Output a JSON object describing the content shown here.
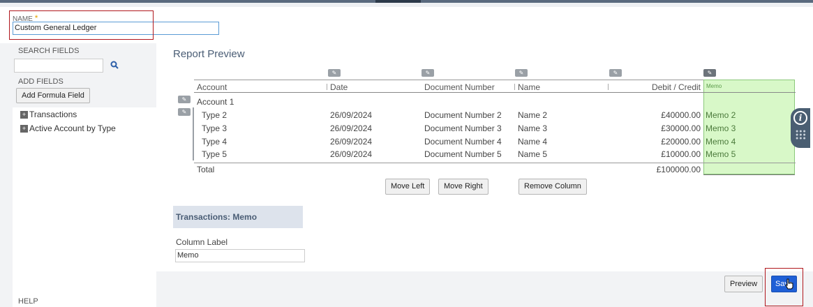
{
  "name_field": {
    "label": "NAME",
    "required_mark": "*",
    "value": "Custom General Ledger"
  },
  "left_panel": {
    "search_label": "SEARCH FIELDS",
    "search_icon": "search-icon",
    "add_fields_label": "ADD FIELDS",
    "add_formula_button": "Add Formula Field",
    "tree": [
      {
        "label": "Transactions",
        "icon": "plus-box-icon"
      },
      {
        "label": "Active Account by Type",
        "icon": "plus-box-icon"
      }
    ],
    "help_label": "HELP"
  },
  "report": {
    "title": "Report Preview",
    "columns": [
      "Account",
      "Date",
      "Document Number",
      "Name",
      "Debit / Credit",
      "Memo"
    ],
    "group_row": "Account 1",
    "rows": [
      {
        "account": "Type 2",
        "date": "26/09/2024",
        "doc": "Document Number 2",
        "name": "Name 2",
        "amount": "£40000.00",
        "memo": "Memo 2"
      },
      {
        "account": "Type 3",
        "date": "26/09/2024",
        "doc": "Document Number 3",
        "name": "Name 3",
        "amount": "£30000.00",
        "memo": "Memo 3"
      },
      {
        "account": "Type 4",
        "date": "26/09/2024",
        "doc": "Document Number 4",
        "name": "Name 4",
        "amount": "£20000.00",
        "memo": "Memo 4"
      },
      {
        "account": "Type 5",
        "date": "26/09/2024",
        "doc": "Document Number 5",
        "name": "Name 5",
        "amount": "£10000.00",
        "memo": "Memo 5"
      }
    ],
    "total_label": "Total",
    "total_amount": "£100000.00",
    "buttons": {
      "move_left": "Move Left",
      "move_right": "Move Right",
      "remove_column": "Remove Column"
    }
  },
  "field_details": {
    "title": "Transactions: Memo",
    "column_label_caption": "Column Label",
    "column_label_value": "Memo"
  },
  "footer": {
    "preview": "Preview",
    "save": "Save"
  },
  "info_badge": {
    "icon": "info-icon",
    "handle": "drag-handle-icon"
  },
  "colors": {
    "accent": "#1f5fd6",
    "highlight": "#b0161c",
    "memo_bg": "#d8f8c8",
    "memo_text": "#4b7a3b",
    "heading": "#4a5d75"
  }
}
